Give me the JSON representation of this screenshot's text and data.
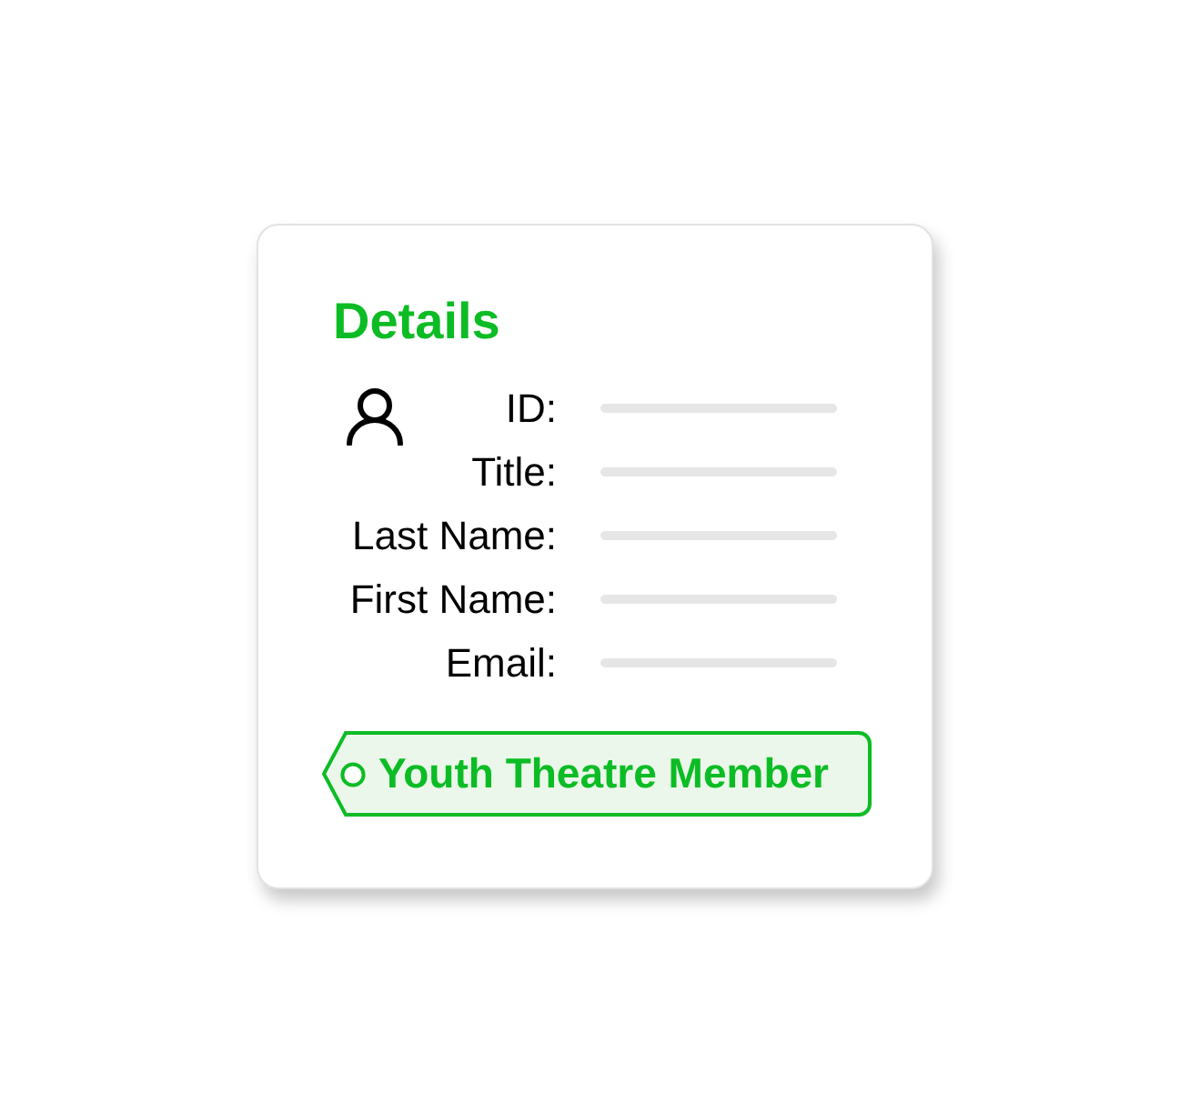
{
  "card": {
    "title": "Details",
    "fields": [
      {
        "label": "ID:"
      },
      {
        "label": "Title:"
      },
      {
        "label": "Last Name:"
      },
      {
        "label": "First Name:"
      },
      {
        "label": "Email:"
      }
    ],
    "tag": {
      "label": "Youth Theatre Member"
    }
  }
}
